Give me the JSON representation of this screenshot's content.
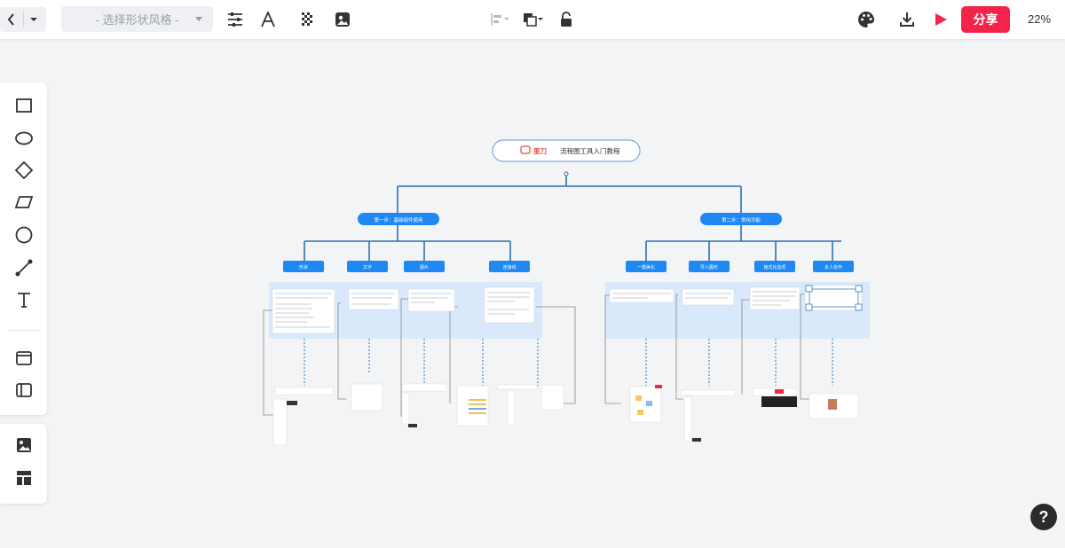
{
  "toolbar": {
    "shape_style_placeholder": "- 选择形状风格 -",
    "share_label": "分享",
    "zoom": "22%"
  },
  "diagram": {
    "root": {
      "logo_text": "里刀",
      "title": "流程图工具入门教程"
    },
    "branches": [
      {
        "label": "第一步：基础组件使用",
        "children": [
          "形状",
          "文字",
          "图片",
          "连接线"
        ]
      },
      {
        "label": "第二步：常用功能",
        "children": [
          "一键美化",
          "导入图形",
          "格式化选项",
          "多人协作"
        ]
      }
    ]
  },
  "colors": {
    "accent": "#f5224a",
    "node_blue": "#1e88f5",
    "connector": "#2f6fb0",
    "panel": "#d9e9fb"
  }
}
